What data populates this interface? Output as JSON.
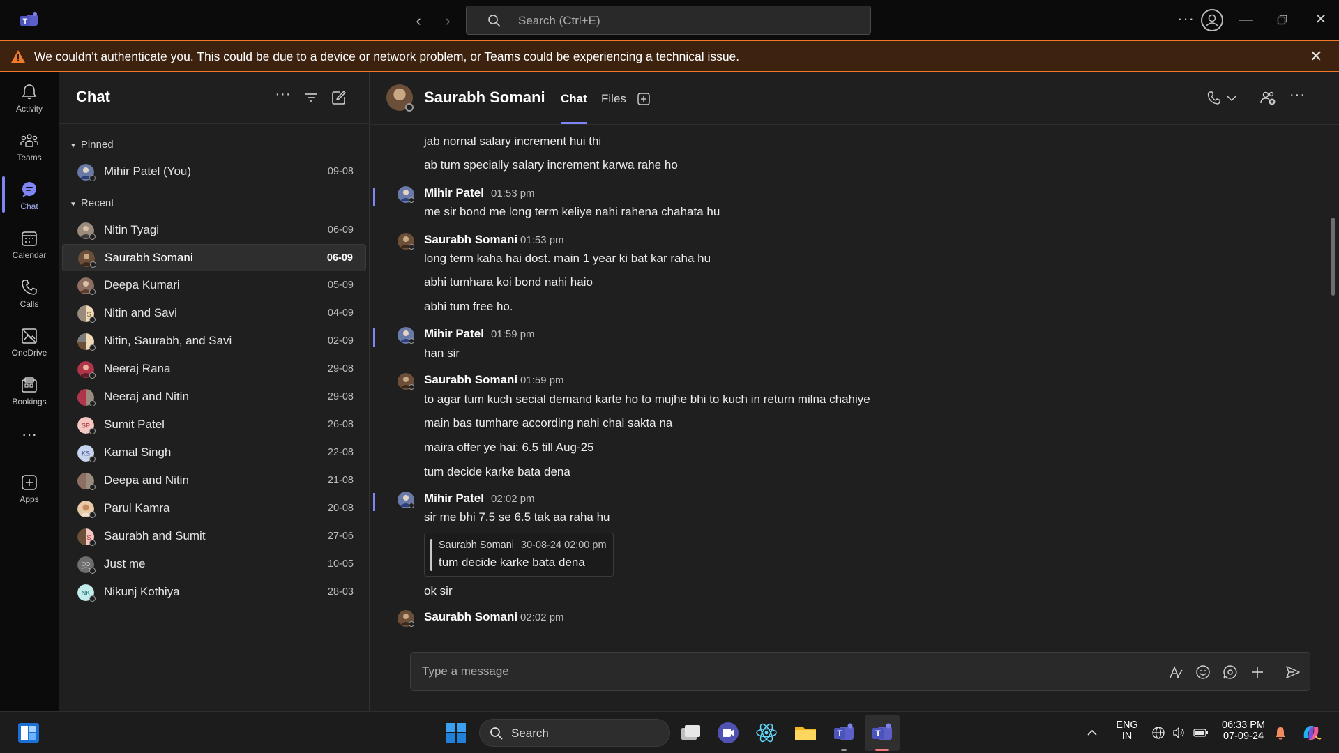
{
  "titlebar": {
    "search_placeholder": "Search (Ctrl+E)",
    "more_label": "···"
  },
  "banner": {
    "message": "We couldn't authenticate you. This could be due to a device or network problem, or Teams could be experiencing a technical issue.",
    "close_label": "✕"
  },
  "rail": {
    "items": [
      {
        "label": "Activity",
        "icon": "bell-icon"
      },
      {
        "label": "Teams",
        "icon": "teams-icon"
      },
      {
        "label": "Chat",
        "icon": "chat-icon",
        "active": true
      },
      {
        "label": "Calendar",
        "icon": "calendar-icon"
      },
      {
        "label": "Calls",
        "icon": "phone-icon"
      },
      {
        "label": "OneDrive",
        "icon": "onedrive-icon"
      },
      {
        "label": "Bookings",
        "icon": "bookings-icon"
      },
      {
        "label": "Apps",
        "icon": "add-apps-icon"
      }
    ],
    "more_label": "···"
  },
  "chatlist": {
    "title": "Chat",
    "pinned_label": "Pinned",
    "recent_label": "Recent",
    "pinned": [
      {
        "name": "Mihir Patel (You)",
        "date": "09-08"
      }
    ],
    "recent": [
      {
        "name": "Nitin Tyagi",
        "date": "06-09"
      },
      {
        "name": "Saurabh Somani",
        "date": "06-09",
        "selected": true
      },
      {
        "name": "Deepa Kumari",
        "date": "05-09"
      },
      {
        "name": "Nitin and Savi",
        "date": "04-09"
      },
      {
        "name": "Nitin, Saurabh, and Savi",
        "date": "02-09"
      },
      {
        "name": "Neeraj Rana",
        "date": "29-08"
      },
      {
        "name": "Neeraj and Nitin",
        "date": "29-08"
      },
      {
        "name": "Sumit Patel",
        "date": "26-08",
        "initials": "SP"
      },
      {
        "name": "Kamal Singh",
        "date": "22-08",
        "initials": "KS"
      },
      {
        "name": "Deepa and Nitin",
        "date": "21-08"
      },
      {
        "name": "Parul Kamra",
        "date": "20-08"
      },
      {
        "name": "Saurabh and Sumit",
        "date": "27-06",
        "initials": "S"
      },
      {
        "name": "Just me",
        "date": "10-05"
      },
      {
        "name": "Nikunj Kothiya",
        "date": "28-03",
        "initials": "NK"
      }
    ]
  },
  "conversation": {
    "contact_name": "Saurabh Somani",
    "tabs": [
      "Chat",
      "Files"
    ],
    "composer_placeholder": "Type a message",
    "messages": {
      "l1": "jab nornal salary increment hui thi",
      "l2": "ab tum specially salary increment karwa rahe ho",
      "a1": "Mihir Patel",
      "t1": "01:53 pm",
      "l3": "me sir bond me long term keliye nahi rahena chahata hu",
      "a2": "Saurabh Somani",
      "t2": "01:53 pm",
      "l4": "long term kaha hai dost. main 1 year ki bat kar raha hu",
      "l5": "abhi tumhara koi bond nahi haio",
      "l6": "abhi tum free ho.",
      "a3": "Mihir Patel",
      "t3": "01:59 pm",
      "l7": "han sir",
      "a4": "Saurabh Somani",
      "t4": "01:59 pm",
      "l8": "to agar tum kuch secial demand karte ho to mujhe bhi to kuch in return milna chahiye",
      "l9": "main bas tumhare according nahi chal sakta na",
      "l10": "maira offer ye hai: 6.5 till Aug-25",
      "l11": "tum decide karke bata dena",
      "a5": "Mihir Patel",
      "t5": "02:02 pm",
      "l12": "sir  me bhi 7.5 se 6.5 tak aa raha hu",
      "quote_author": "Saurabh Somani",
      "quote_time": "30-08-24 02:00 pm",
      "quote_text": "tum decide karke bata dena",
      "l13": "ok sir",
      "a6": "Saurabh Somani",
      "t6": "02:02 pm"
    }
  },
  "taskbar": {
    "search_label": "Search",
    "lang_line1": "ENG",
    "lang_line2": "IN",
    "time": "06:33 PM",
    "date": "07-09-24"
  },
  "colors": {
    "accent": "#7f85f5",
    "banner_border": "#f07a2a",
    "banner_bg": "#3d220f"
  }
}
